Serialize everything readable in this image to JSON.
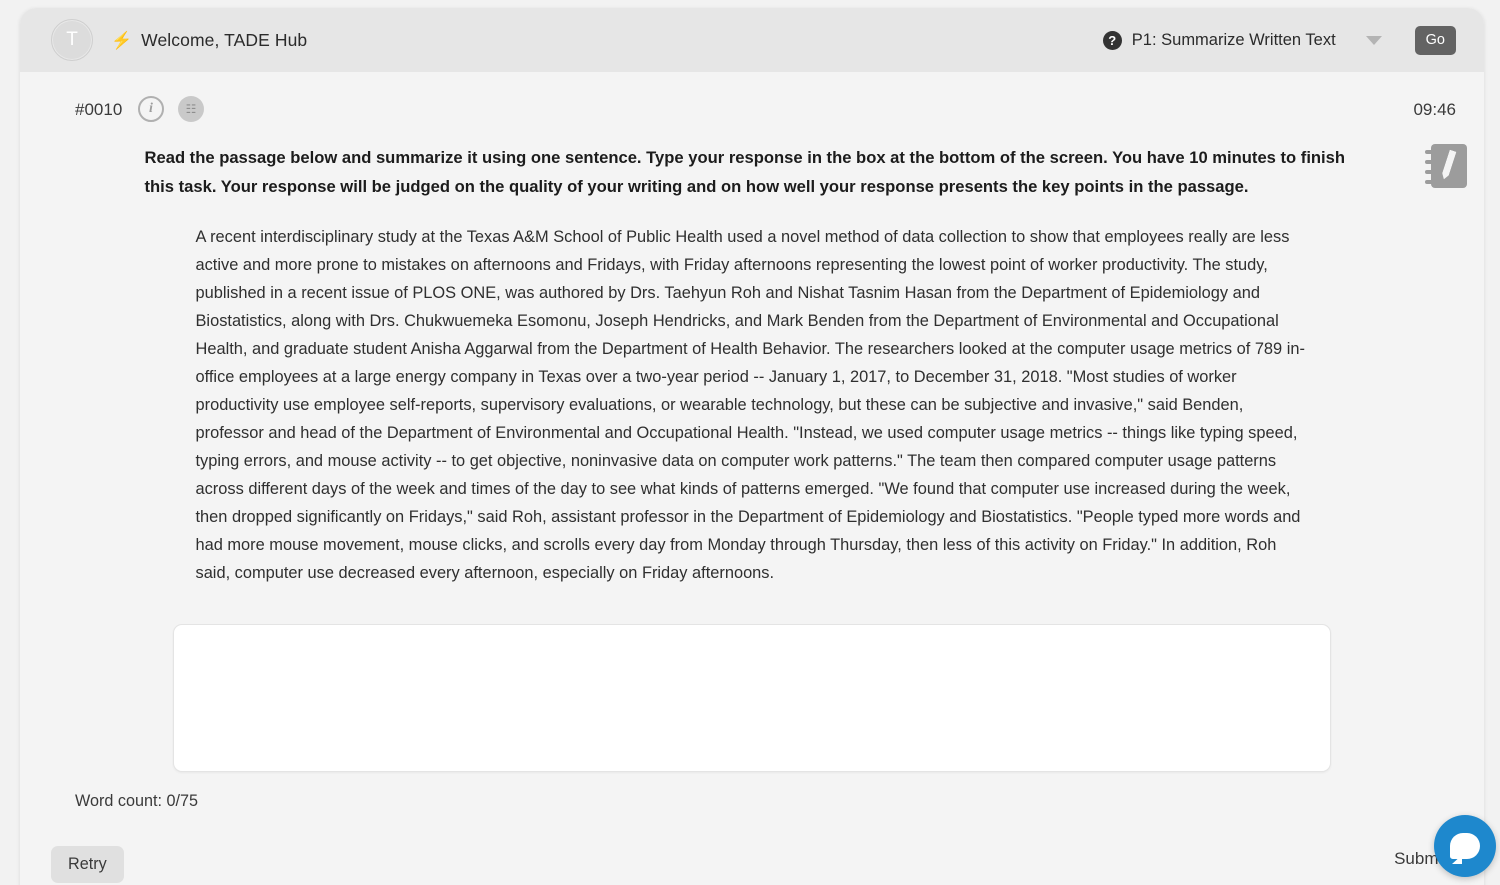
{
  "topbar": {
    "avatar_initial": "T",
    "bolt_icon": "lightning-bolt-icon",
    "welcome": "Welcome, TADE Hub",
    "help_icon_label": "?",
    "task_selected": "P1: Summarize Written Text",
    "go_label": "Go"
  },
  "item": {
    "number": "#0010",
    "info_icon_label": "i",
    "dictionary_icon_label": "☷",
    "timer": "09:46"
  },
  "instructions": "Read the passage below and summarize it using one sentence. Type your response in the box at the bottom of the screen. You have 10 minutes to finish this task. Your response will be judged on the quality of your writing and on how well your response presents the key points in the passage.",
  "passage": "A recent interdisciplinary study at the Texas A&M School of Public Health used a novel method of data collection to show that employees really are less active and more prone to mistakes on afternoons and Fridays, with Friday afternoons representing the lowest point of worker productivity. The study, published in a recent issue of PLOS ONE, was authored by Drs. Taehyun Roh and Nishat Tasnim Hasan from the Department of Epidemiology and Biostatistics, along with Drs. Chukwuemeka Esomonu, Joseph Hendricks, and Mark Benden from the Department of Environmental and Occupational Health, and graduate student Anisha Aggarwal from the Department of Health Behavior. The researchers looked at the computer usage metrics of 789 in-office employees at a large energy company in Texas over a two-year period -- January 1, 2017, to December 31, 2018. \"Most studies of worker productivity use employee self-reports, supervisory evaluations, or wearable technology, but these can be subjective and invasive,\" said Benden, professor and head of the Department of Environmental and Occupational Health. \"Instead, we used computer usage metrics -- things like typing speed, typing errors, and mouse activity -- to get objective, noninvasive data on computer work patterns.\" The team then compared computer usage patterns across different days of the week and times of the day to see what kinds of patterns emerged. \"We found that computer use increased during the week, then dropped significantly on Fridays,\" said Roh, assistant professor in the Department of Epidemiology and Biostatistics. \"People typed more words and had more mouse movement, mouse clicks, and scrolls every day from Monday through Thursday, then less of this activity on Friday.\" In addition, Roh said, computer use decreased every afternoon, especially on Friday afternoons.",
  "answer": {
    "value": "",
    "placeholder": "",
    "word_count": "Word count: 0/75"
  },
  "footer": {
    "retry_label": "Retry",
    "submit_label": "Submit"
  },
  "chat": {
    "icon": "chat-bubble-icon"
  },
  "colors": {
    "topbar_bg": "#e6e6e6",
    "page_bg": "#f4f4f4",
    "go_button": "#636363",
    "chat_accent": "#1e88cd",
    "text": "#2f2f2f"
  }
}
